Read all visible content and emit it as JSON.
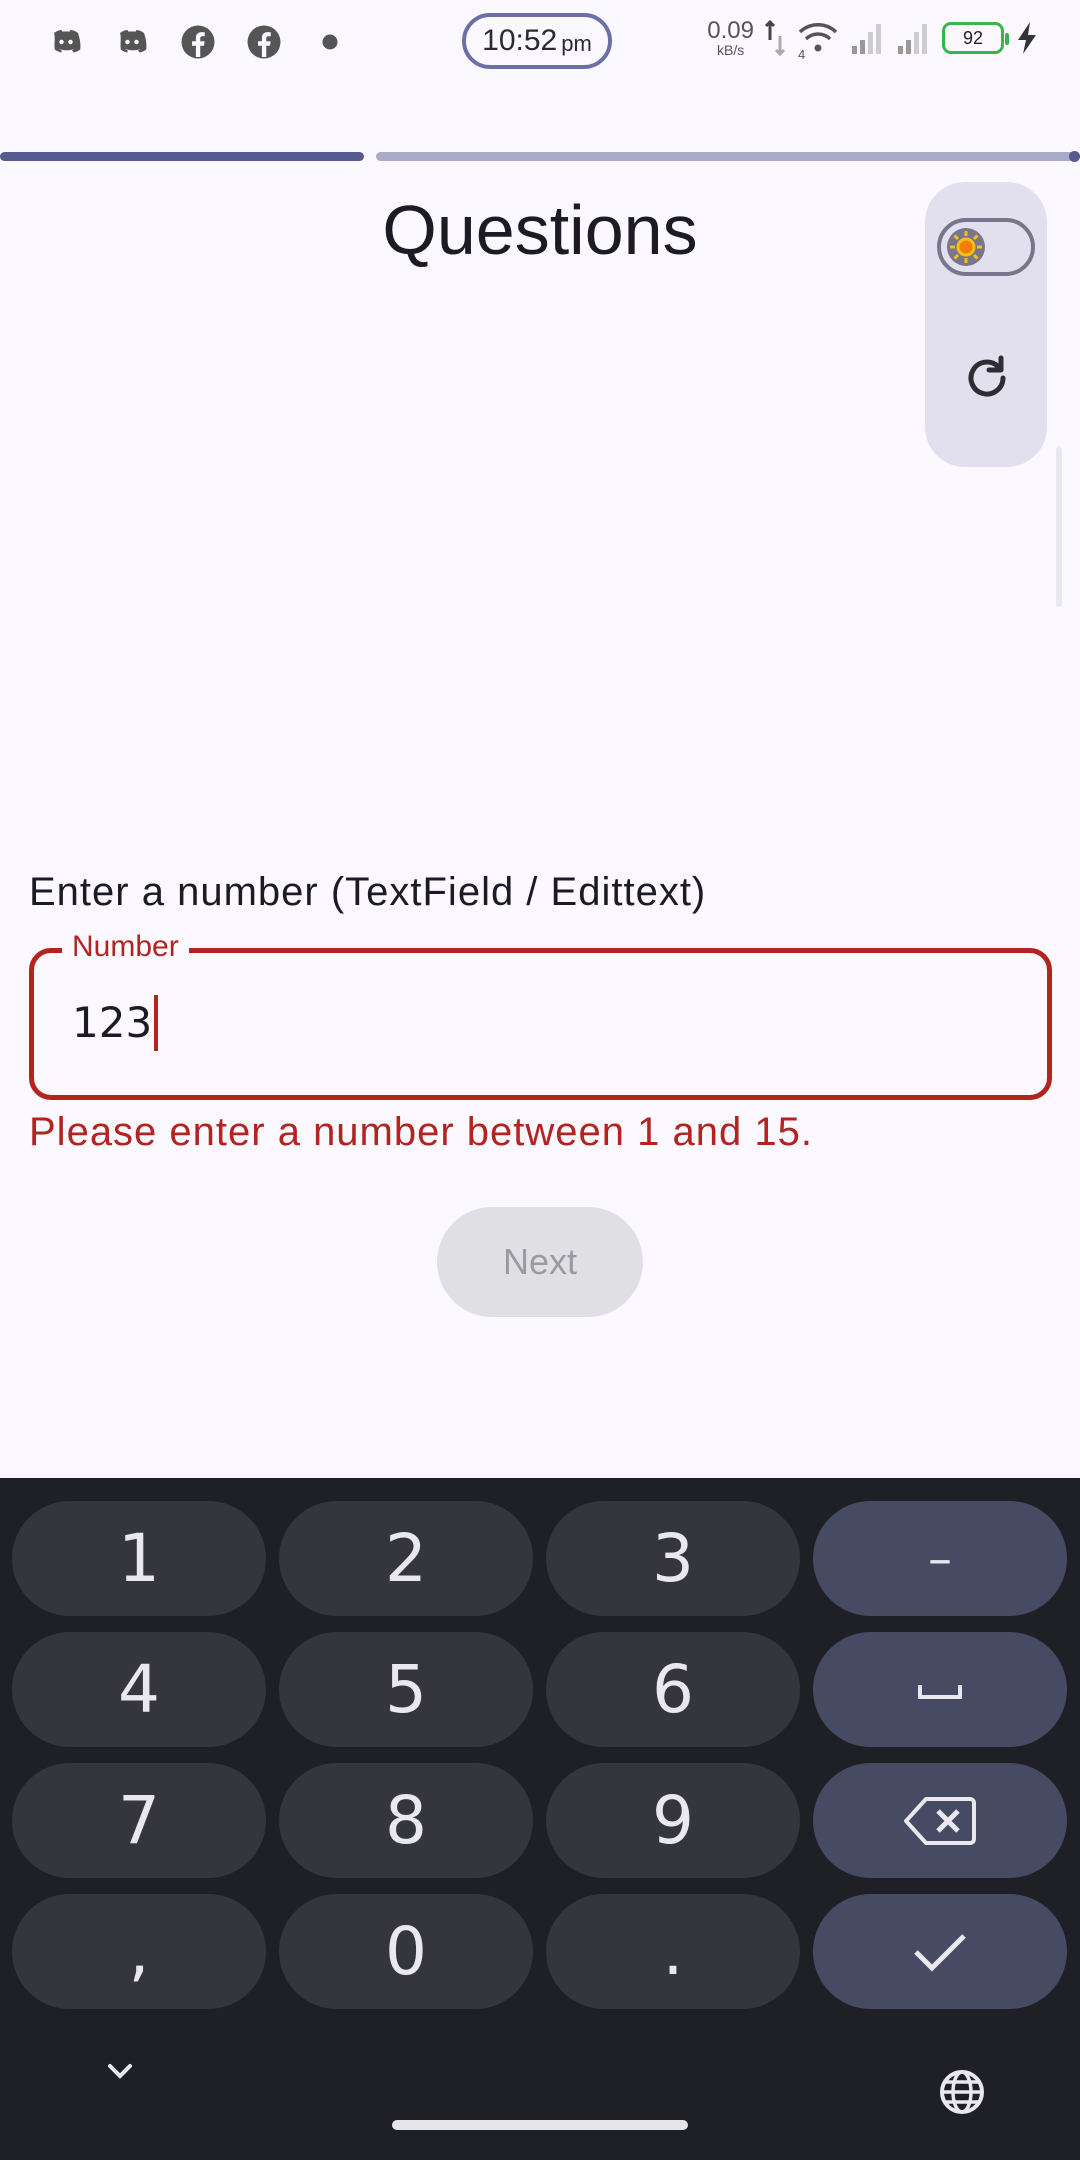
{
  "status_bar": {
    "time": "10:52",
    "ampm": "pm",
    "net_speed": "0.09",
    "net_unit": "kB/s",
    "network_type": "4",
    "battery": "92",
    "icons": [
      "discord-icon",
      "discord-icon",
      "facebook-icon",
      "facebook-icon",
      "dot-icon"
    ]
  },
  "progress": {
    "completed_fraction": 0.34
  },
  "page": {
    "title": "Questions"
  },
  "question": {
    "label": "Enter a number (TextField / Edittext)",
    "field_label": "Number",
    "value": "123",
    "error": "Please enter a number between 1 and 15."
  },
  "next_button": {
    "label": "Next",
    "enabled": false
  },
  "keyboard": {
    "keys": {
      "k1": "1",
      "k2": "2",
      "k3": "3",
      "minus": "–",
      "k4": "4",
      "k5": "5",
      "k6": "6",
      "k7": "7",
      "k8": "8",
      "k9": "9",
      "comma": ",",
      "k0": "0",
      "period": "."
    }
  },
  "colors": {
    "background": "#fcf8ff",
    "accent": "#555a8f",
    "error": "#b3231f",
    "keyboard_bg": "#1f1f26",
    "key_bg": "#35353d",
    "fn_key_bg": "#474a63"
  }
}
